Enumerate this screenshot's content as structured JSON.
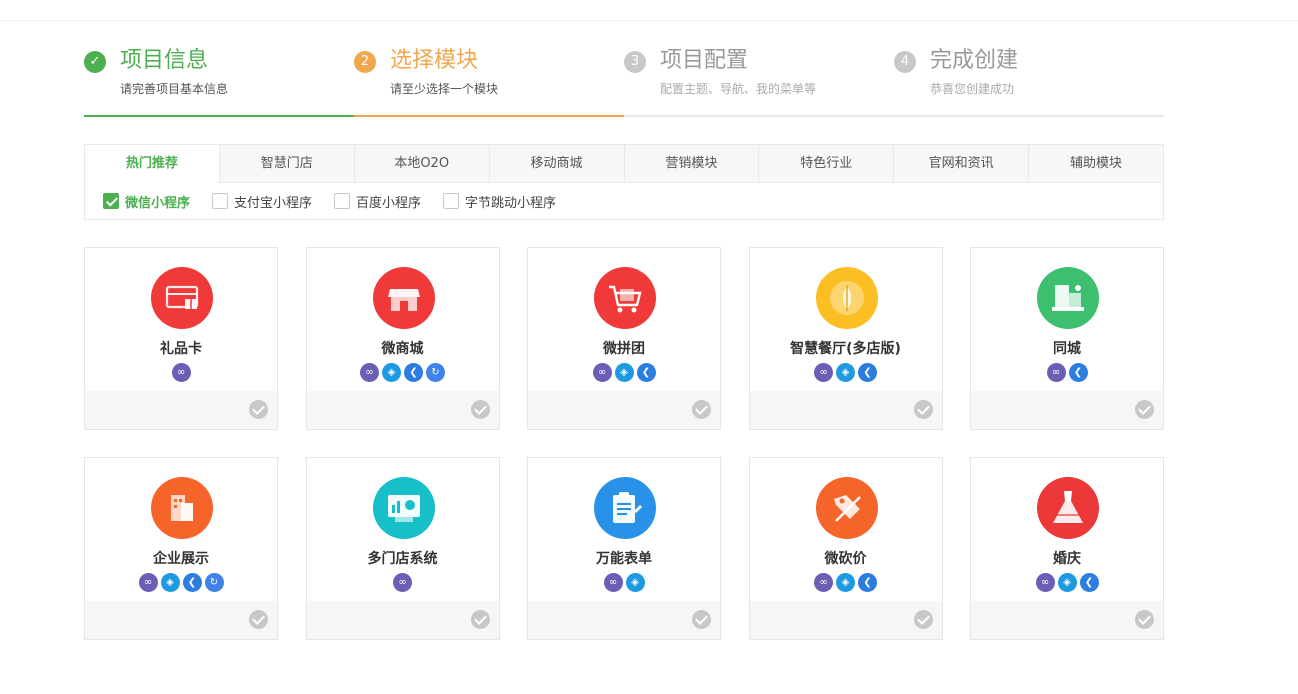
{
  "steps": [
    {
      "num": "✓",
      "title": "项目信息",
      "sub": "请完善项目基本信息"
    },
    {
      "num": "2",
      "title": "选择模块",
      "sub": "请至少选择一个模块"
    },
    {
      "num": "3",
      "title": "项目配置",
      "sub": "配置主题、导航、我的菜单等"
    },
    {
      "num": "4",
      "title": "完成创建",
      "sub": "恭喜您创建成功"
    }
  ],
  "tabs": [
    "热门推荐",
    "智慧门店",
    "本地O2O",
    "移动商城",
    "营销模块",
    "特色行业",
    "官网和资讯",
    "辅助模块"
  ],
  "platforms": [
    {
      "label": "微信小程序",
      "checked": true
    },
    {
      "label": "支付宝小程序",
      "checked": false
    },
    {
      "label": "百度小程序",
      "checked": false
    },
    {
      "label": "字节跳动小程序",
      "checked": false
    }
  ],
  "cards": [
    {
      "name": "礼品卡",
      "icon": "gift-card-icon",
      "color": "#f03a3a",
      "badges": [
        "wx"
      ]
    },
    {
      "name": "微商城",
      "icon": "storefront-icon",
      "color": "#f03a3a",
      "badges": [
        "wx",
        "ali",
        "bd",
        "zj"
      ]
    },
    {
      "name": "微拼团",
      "icon": "shopping-cart-icon",
      "color": "#f03a3a",
      "badges": [
        "wx",
        "ali",
        "bd"
      ]
    },
    {
      "name": "智慧餐厅(多店版)",
      "icon": "dining-icon",
      "color": "#fbbf24",
      "badges": [
        "wx",
        "ali",
        "bd"
      ]
    },
    {
      "name": "同城",
      "icon": "city-icon",
      "color": "#3cbf6e",
      "badges": [
        "wx",
        "bd"
      ]
    },
    {
      "name": "企业展示",
      "icon": "building-icon",
      "color": "#f5652a",
      "badges": [
        "wx",
        "ali",
        "bd",
        "zj"
      ]
    },
    {
      "name": "多门店系统",
      "icon": "chart-board-icon",
      "color": "#17bfc8",
      "badges": [
        "wx"
      ]
    },
    {
      "name": "万能表单",
      "icon": "clipboard-icon",
      "color": "#2892e8",
      "badges": [
        "wx",
        "ali"
      ]
    },
    {
      "name": "微砍价",
      "icon": "price-tag-icon",
      "color": "#f5652a",
      "badges": [
        "wx",
        "ali",
        "bd"
      ]
    },
    {
      "name": "婚庆",
      "icon": "wedding-dress-icon",
      "color": "#ec3838",
      "badges": [
        "wx",
        "ali",
        "bd"
      ]
    }
  ],
  "badge_colors": {
    "wx": "#6b5fb5",
    "ali": "#1e9ae0",
    "bd": "#2c7de0",
    "zj": "#3f82e8"
  },
  "accent_green": "#4caf50",
  "accent_orange": "#f0a84e"
}
